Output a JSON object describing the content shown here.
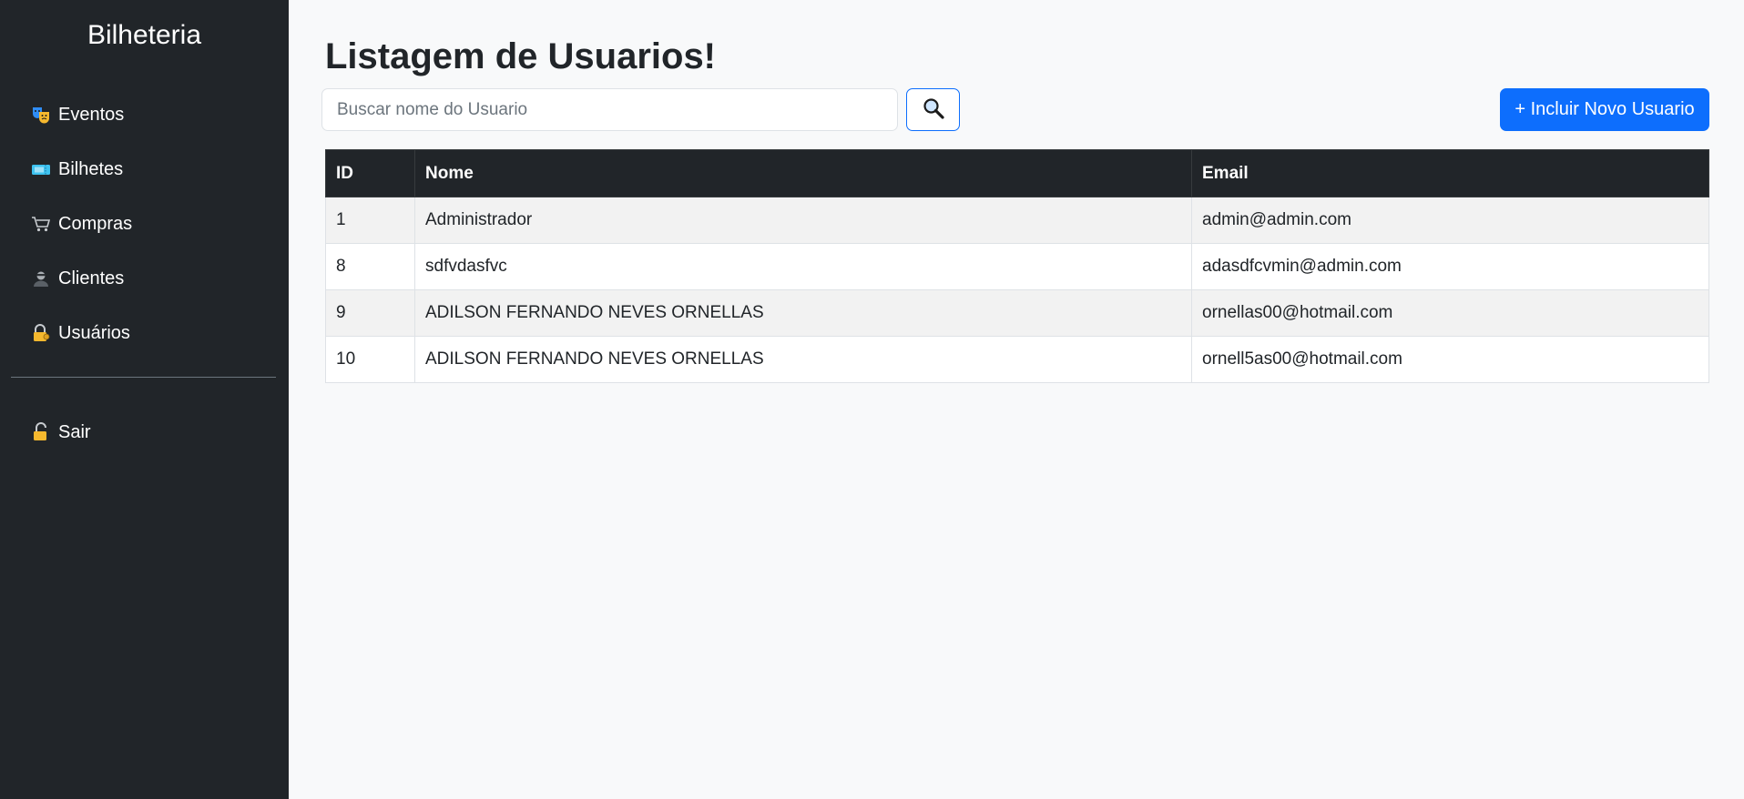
{
  "sidebar": {
    "brand": "Bilheteria",
    "items": [
      {
        "label": "Eventos",
        "icon": "theater-masks-icon"
      },
      {
        "label": "Bilhetes",
        "icon": "ticket-icon"
      },
      {
        "label": "Compras",
        "icon": "shopping-cart-icon"
      },
      {
        "label": "Clientes",
        "icon": "user-icon"
      },
      {
        "label": "Usuários",
        "icon": "lock-key-icon"
      }
    ],
    "logout": {
      "label": "Sair",
      "icon": "unlock-icon"
    }
  },
  "main": {
    "title": "Listagem de Usuarios!",
    "search": {
      "placeholder": "Buscar nome do Usuario",
      "value": "",
      "button_icon": "search-icon"
    },
    "add_button_label": "+ Incluir Novo Usuario",
    "table": {
      "headers": [
        "ID",
        "Nome",
        "Email"
      ],
      "rows": [
        {
          "id": "1",
          "nome": "Administrador",
          "email": "admin@admin.com"
        },
        {
          "id": "8",
          "nome": "sdfvdasfvc",
          "email": "adasdfcvmin@admin.com"
        },
        {
          "id": "9",
          "nome": "ADILSON FERNANDO NEVES ORNELLAS",
          "email": "ornellas00@hotmail.com"
        },
        {
          "id": "10",
          "nome": "ADILSON FERNANDO NEVES ORNELLAS",
          "email": "ornell5as00@hotmail.com"
        }
      ]
    }
  },
  "colors": {
    "sidebar_bg": "#212529",
    "primary": "#0d6efd",
    "page_bg": "#f8f9fa"
  }
}
